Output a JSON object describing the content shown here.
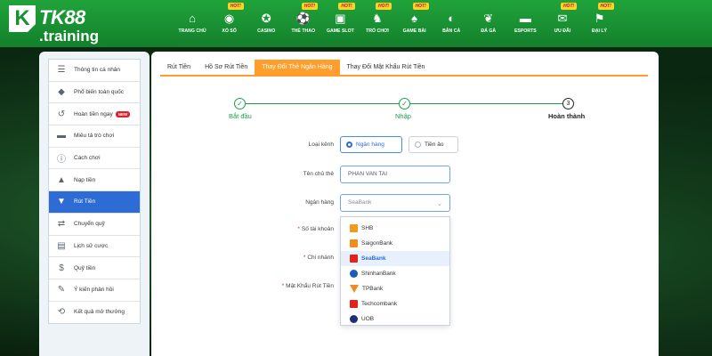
{
  "brand": {
    "logo_mark": "K",
    "name": "TK88",
    "suffix": ".training"
  },
  "nav": [
    {
      "label": "Trang chủ",
      "icon": "home-icon",
      "glyph": "⌂",
      "hot": false
    },
    {
      "label": "Xổ số",
      "icon": "lottery-icon",
      "glyph": "◉",
      "hot": true
    },
    {
      "label": "Casino",
      "icon": "casino-chip-icon",
      "glyph": "✪",
      "hot": false
    },
    {
      "label": "Thể thao",
      "icon": "football-icon",
      "glyph": "⚽",
      "hot": true
    },
    {
      "label": "Game slot",
      "icon": "slot-machine-icon",
      "glyph": "▣",
      "hot": true
    },
    {
      "label": "Trò chơi",
      "icon": "chess-knight-icon",
      "glyph": "♞",
      "hot": true
    },
    {
      "label": "Game bài",
      "icon": "cards-icon",
      "glyph": "♠",
      "hot": true
    },
    {
      "label": "Bắn cá",
      "icon": "fish-icon",
      "glyph": "◐",
      "hot": false
    },
    {
      "label": "Đá gà",
      "icon": "rooster-icon",
      "glyph": "❦",
      "hot": false
    },
    {
      "label": "Esports",
      "icon": "gamepad-icon",
      "glyph": "▬",
      "hot": false
    },
    {
      "label": "Ưu đãi",
      "icon": "gift-icon",
      "glyph": "✉",
      "hot": true
    },
    {
      "label": "Đại lý",
      "icon": "agent-icon",
      "glyph": "⚑",
      "hot": true
    }
  ],
  "hot_label": "HOT!",
  "sidebar": [
    {
      "label": "Thông tin cá nhân",
      "icon": "id-card-icon",
      "glyph": "☰",
      "active": false,
      "badge": ""
    },
    {
      "label": "Phổ biến toàn quốc",
      "icon": "diamond-icon",
      "glyph": "◆",
      "active": false,
      "badge": ""
    },
    {
      "label": "Hoàn tiền ngay",
      "icon": "refund-icon",
      "glyph": "↺",
      "active": false,
      "badge": "NEW"
    },
    {
      "label": "Miêu tả trò chơi",
      "icon": "gamepad-icon",
      "glyph": "▬",
      "active": false,
      "badge": ""
    },
    {
      "label": "Cách chơi",
      "icon": "info-icon",
      "glyph": "ⓘ",
      "active": false,
      "badge": ""
    },
    {
      "label": "Nạp tiền",
      "icon": "piggy-bank-icon",
      "glyph": "▲",
      "active": false,
      "badge": ""
    },
    {
      "label": "Rút Tiền",
      "icon": "withdraw-icon",
      "glyph": "▼",
      "active": true,
      "badge": ""
    },
    {
      "label": "Chuyển quỹ",
      "icon": "transfer-icon",
      "glyph": "⇄",
      "active": false,
      "badge": ""
    },
    {
      "label": "Lịch sử cược",
      "icon": "history-icon",
      "glyph": "▤",
      "active": false,
      "badge": ""
    },
    {
      "label": "Quỹ tiền",
      "icon": "fund-icon",
      "glyph": "$",
      "active": false,
      "badge": ""
    },
    {
      "label": "Ý kiến phản hồi",
      "icon": "feedback-icon",
      "glyph": "✎",
      "active": false,
      "badge": ""
    },
    {
      "label": "Kết quả mở thưởng",
      "icon": "results-icon",
      "glyph": "⟲",
      "active": false,
      "badge": ""
    }
  ],
  "tabs": [
    {
      "label": "Rút Tiền",
      "active": false
    },
    {
      "label": "Hồ Sơ Rút Tiền",
      "active": false
    },
    {
      "label": "Thay Đổi Thẻ Ngân Hàng",
      "active": true
    },
    {
      "label": "Thay Đổi Mật Khẩu Rút Tiền",
      "active": false
    }
  ],
  "steps": [
    {
      "label": "Bắt đầu",
      "marker": "✓",
      "done": true
    },
    {
      "label": "Nhập",
      "marker": "✓",
      "done": true
    },
    {
      "label": "Hoàn thành",
      "marker": "3",
      "done": false
    }
  ],
  "form": {
    "type_label": "Loại kênh",
    "option_bank": "Ngân hàng",
    "option_crypto": "Tiền ảo",
    "holder_label": "Tên chủ thẻ",
    "holder_value": "PHAN VAN TAI",
    "bank_label": "Ngân hàng",
    "bank_value": "SeaBank",
    "account_label": "Số tài khoản",
    "branch_label": "Chi nhánh",
    "password_label": "Mật Khẩu Rút Tiền",
    "required_mark": "*"
  },
  "bank_options": [
    {
      "name": "SHB",
      "color": "#f39a1e",
      "shape": "square"
    },
    {
      "name": "SaigonBank",
      "color": "#f28c1a",
      "shape": "square"
    },
    {
      "name": "SeaBank",
      "color": "#e2231a",
      "shape": "square",
      "selected": true
    },
    {
      "name": "ShinhanBank",
      "color": "#1b5cb8",
      "shape": "round"
    },
    {
      "name": "TPBank",
      "color": "#f08a24",
      "shape": "tri"
    },
    {
      "name": "Techcombank",
      "color": "#e2231a",
      "shape": "square"
    },
    {
      "name": "UOB",
      "color": "#1a2f7a",
      "shape": "round"
    }
  ]
}
